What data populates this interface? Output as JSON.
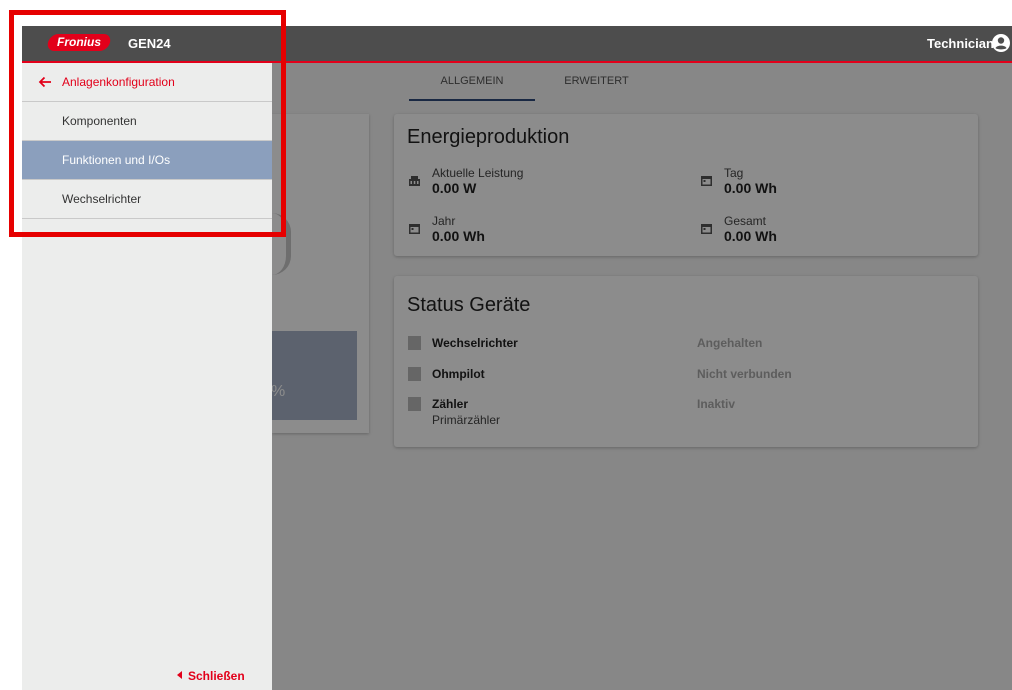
{
  "header": {
    "brand": "Fronius",
    "product": "GEN24",
    "role": "Technician",
    "accent_color": "#e2001a",
    "bar_color": "#4d4d4d"
  },
  "tabs": [
    {
      "label": "ALLGEMEIN",
      "active": true
    },
    {
      "label": "ERWEITERT",
      "active": false
    }
  ],
  "energy": {
    "title": "Energieproduktion",
    "metrics": [
      {
        "label": "Aktuelle Leistung",
        "value": "0.00 W",
        "icon": "power-plant-icon"
      },
      {
        "label": "Tag",
        "value": "0.00 Wh",
        "icon": "calendar-icon"
      },
      {
        "label": "Jahr",
        "value": "0.00 Wh",
        "icon": "calendar-icon"
      },
      {
        "label": "Gesamt",
        "value": "0.00 Wh",
        "icon": "calendar-icon"
      }
    ]
  },
  "status": {
    "title": "Status Geräte",
    "devices": [
      {
        "name": "Wechselrichter",
        "sub": "",
        "status": "Angehalten",
        "icon": "inverter-icon"
      },
      {
        "name": "Ohmpilot",
        "sub": "",
        "status": "Nicht verbunden",
        "icon": "ohmpilot-icon"
      },
      {
        "name": "Zähler",
        "sub": "Primärzähler",
        "status": "Inaktiv",
        "icon": "meter-icon"
      }
    ]
  },
  "left_panel": {
    "percent_text": "%"
  },
  "drawer": {
    "back_label": "Anlagenkonfiguration",
    "items": [
      {
        "label": "Komponenten",
        "active": false
      },
      {
        "label": "Funktionen und I/Os",
        "active": true
      },
      {
        "label": "Wechselrichter",
        "active": false
      }
    ],
    "close_label": "Schließen",
    "active_color": "#8b9fbd"
  }
}
